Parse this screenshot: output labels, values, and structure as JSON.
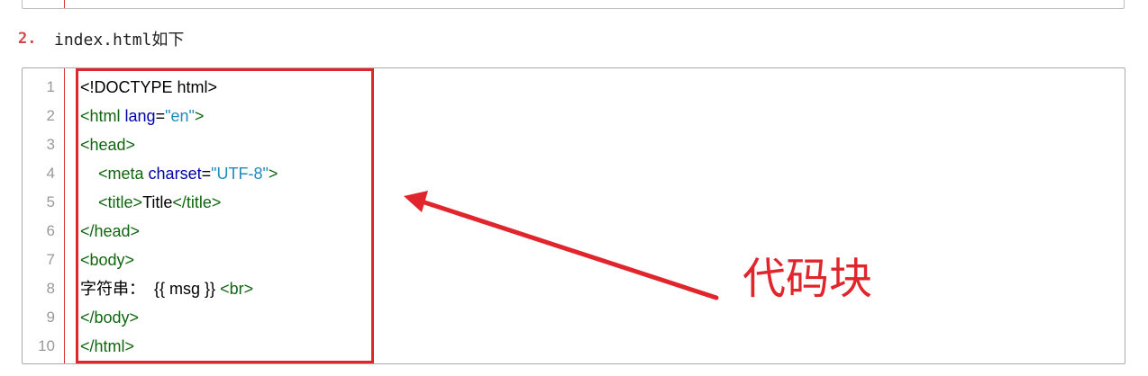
{
  "list_item": {
    "number": "2.",
    "text": "index.html如下"
  },
  "code_block": {
    "line_numbers": [
      "1",
      "2",
      "3",
      "4",
      "5",
      "6",
      "7",
      "8",
      "9",
      "10"
    ],
    "lines": [
      [
        {
          "t": "plain",
          "v": "<!DOCTYPE html>"
        }
      ],
      [
        {
          "t": "tag",
          "v": "<html "
        },
        {
          "t": "attr",
          "v": "lang"
        },
        {
          "t": "plain",
          "v": "="
        },
        {
          "t": "val",
          "v": "\"en\""
        },
        {
          "t": "tag",
          "v": ">"
        }
      ],
      [
        {
          "t": "tag",
          "v": "<head>"
        }
      ],
      [
        {
          "t": "plain",
          "v": "    "
        },
        {
          "t": "tag",
          "v": "<meta "
        },
        {
          "t": "attr",
          "v": "charset"
        },
        {
          "t": "plain",
          "v": "="
        },
        {
          "t": "val",
          "v": "\"UTF-8\""
        },
        {
          "t": "tag",
          "v": ">"
        }
      ],
      [
        {
          "t": "plain",
          "v": "    "
        },
        {
          "t": "tag",
          "v": "<title>"
        },
        {
          "t": "plain",
          "v": "Title"
        },
        {
          "t": "tag",
          "v": "</title>"
        }
      ],
      [
        {
          "t": "tag",
          "v": "</head>"
        }
      ],
      [
        {
          "t": "tag",
          "v": "<body>"
        }
      ],
      [
        {
          "t": "plain",
          "v": "字符串：  {{ msg }} "
        },
        {
          "t": "tag",
          "v": "<br>"
        }
      ],
      [
        {
          "t": "tag",
          "v": "</body>"
        }
      ],
      [
        {
          "t": "tag",
          "v": "</html>"
        }
      ]
    ]
  },
  "annotation": {
    "label": "代码块",
    "color": "#e0252d"
  },
  "colors": {
    "tag": "#116611",
    "attr": "#0000aa",
    "value": "#1f8bb8",
    "gutter_border": "#d93636",
    "list_number": "#d04a4a"
  }
}
